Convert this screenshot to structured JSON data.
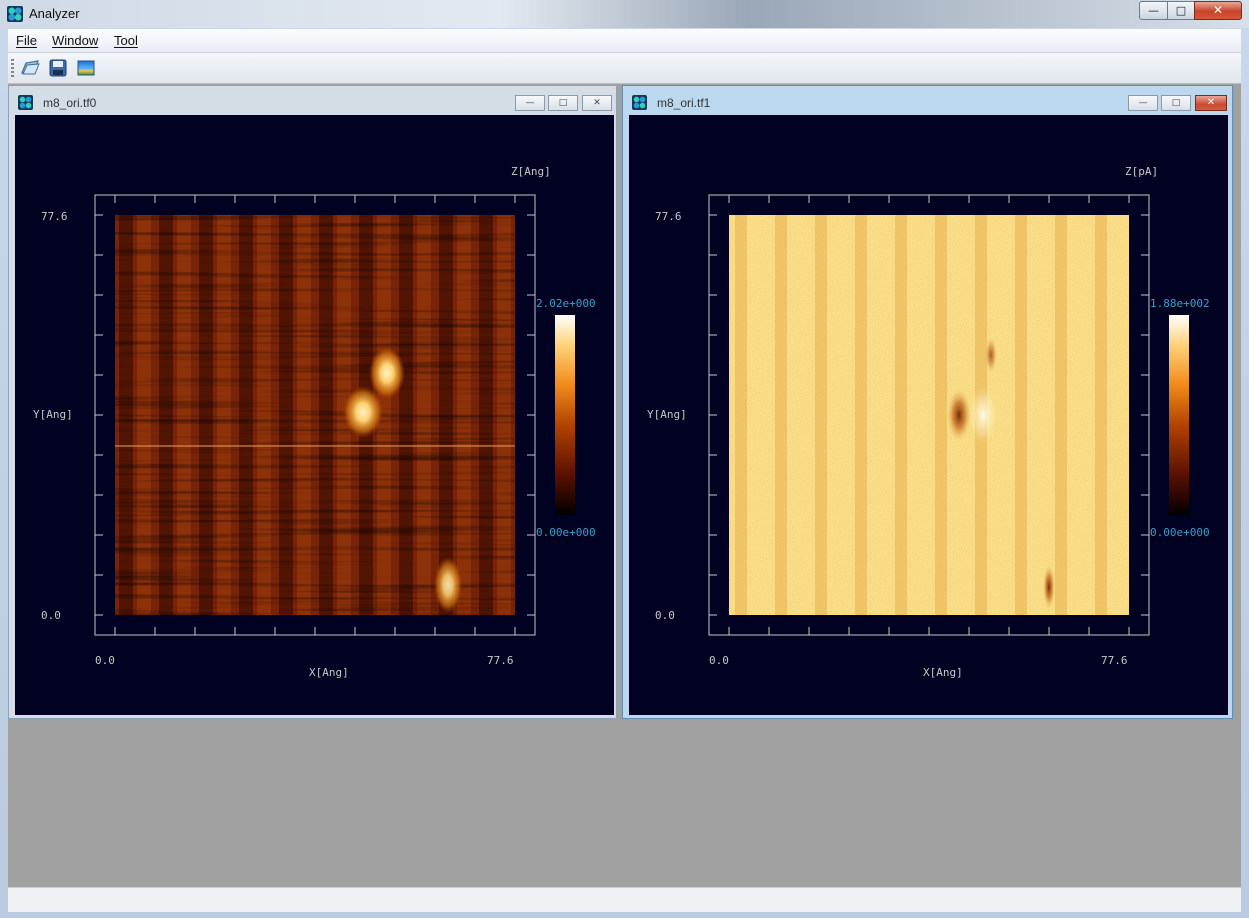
{
  "app": {
    "title": "Analyzer"
  },
  "window_controls": {
    "minimize": "minimize",
    "maximize": "maximize",
    "close": "close"
  },
  "menu": {
    "items": [
      {
        "label": "File"
      },
      {
        "label": "Window"
      },
      {
        "label": "Tool"
      }
    ]
  },
  "toolbar": {
    "buttons": [
      {
        "icon": "open-folder-icon"
      },
      {
        "icon": "save-disk-icon"
      },
      {
        "icon": "image-icon"
      }
    ]
  },
  "windows": [
    {
      "title": "m8_ori.tf0",
      "active": false,
      "z_label": "Z[Ang]",
      "y_label": "Y[Ang]",
      "x_label": "X[Ang]",
      "y_max": "77.6",
      "y_min": "0.0",
      "x_min": "0.0",
      "x_max": "77.6",
      "colorbar_max": "2.02e+000",
      "colorbar_min": "0.00e+000",
      "colormap": [
        "#000000",
        "#5a1000",
        "#b34300",
        "#f08a1a",
        "#ffd27a",
        "#ffffff"
      ],
      "image_base_color": "#7a2407"
    },
    {
      "title": "m8_ori.tf1",
      "active": true,
      "z_label": "Z[pA]",
      "y_label": "Y[Ang]",
      "x_label": "X[Ang]",
      "y_max": "77.6",
      "y_min": "0.0",
      "x_min": "0.0",
      "x_max": "77.6",
      "colorbar_max": "1.88e+002",
      "colorbar_min": "0.00e+000",
      "colormap": [
        "#000000",
        "#5a1000",
        "#b34300",
        "#f08a1a",
        "#ffd27a",
        "#ffffff"
      ],
      "image_base_color": "#fbe08a"
    }
  ],
  "colors": {
    "plot_background": "#010221",
    "axis": "#c8c8c8",
    "colorbar_label": "#3aa0c8"
  }
}
